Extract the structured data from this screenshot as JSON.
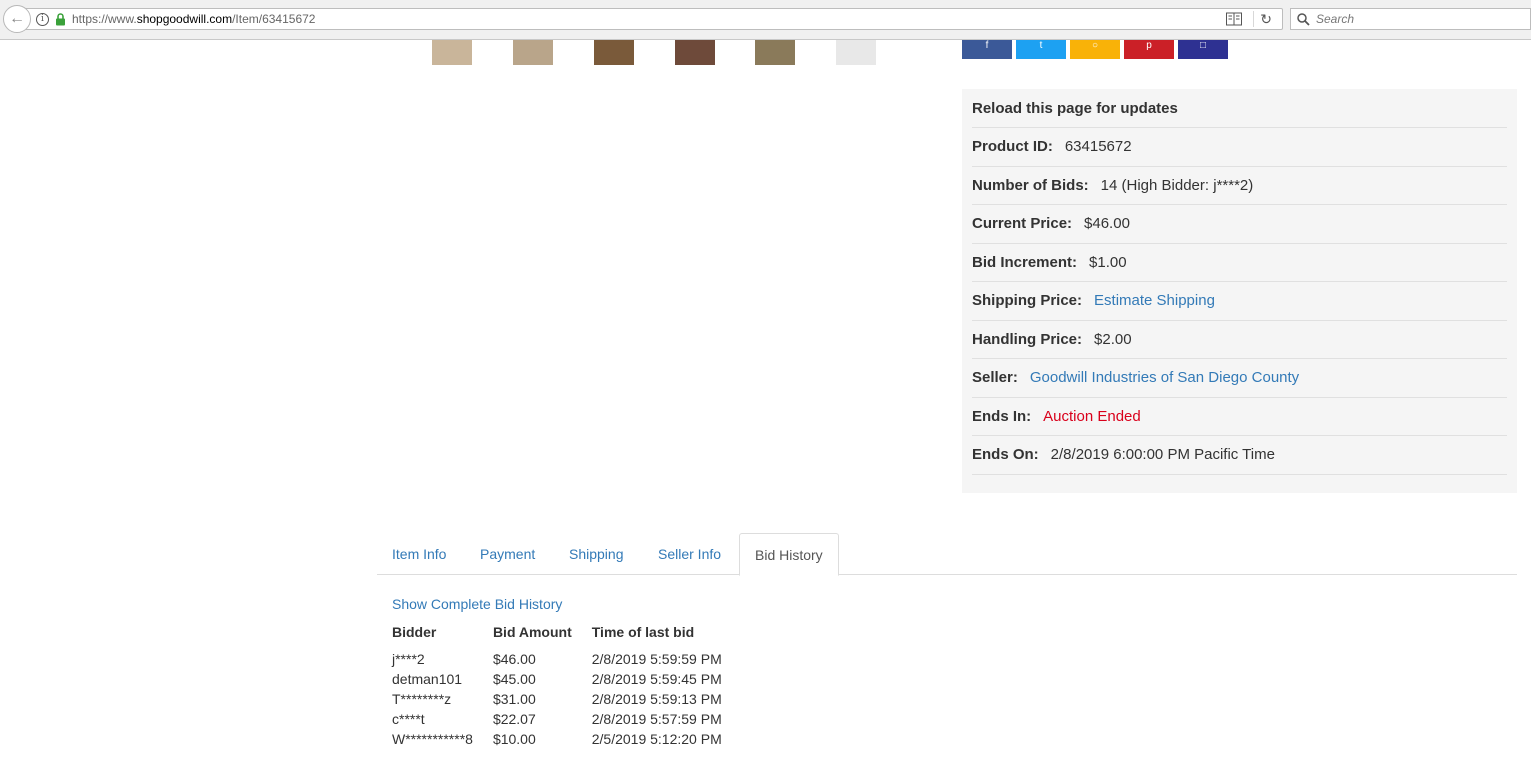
{
  "browser": {
    "url_prefix": "https://www.",
    "url_host": "shopgoodwill.com",
    "url_path": "/Item/63415672",
    "search_placeholder": "Search"
  },
  "thumbnails": [
    {
      "name": "thumbnail-1",
      "color": "#c9b59a"
    },
    {
      "name": "thumbnail-2",
      "color": "#b9a58a"
    },
    {
      "name": "thumbnail-3",
      "color": "#7a5a3a"
    },
    {
      "name": "thumbnail-4",
      "color": "#6e4a3a"
    },
    {
      "name": "thumbnail-5",
      "color": "#8a7a5a"
    },
    {
      "name": "thumbnail-6",
      "color": "#e8e8e8"
    }
  ],
  "share_buttons": [
    {
      "name": "facebook-share-button",
      "color": "#3b5998",
      "icon": "facebook-icon"
    },
    {
      "name": "twitter-share-button",
      "color": "#1da1f2",
      "icon": "twitter-icon"
    },
    {
      "name": "reddit-share-button",
      "color": "#f9b208",
      "icon": "share-icon"
    },
    {
      "name": "pinterest-share-button",
      "color": "#cb2027",
      "icon": "pinterest-icon"
    },
    {
      "name": "email-share-button",
      "color": "#2e3192",
      "icon": "email-icon"
    }
  ],
  "panel": {
    "reload": "Reload this page for updates",
    "product_id_label": "Product ID:",
    "product_id": "63415672",
    "bids_label": "Number of Bids:",
    "bids": "14 (High Bidder: j****2)",
    "price_label": "Current Price:",
    "price": "$46.00",
    "increment_label": "Bid Increment:",
    "increment": "$1.00",
    "shipping_label": "Shipping Price:",
    "shipping": "Estimate Shipping",
    "handling_label": "Handling Price:",
    "handling": "$2.00",
    "seller_label": "Seller:",
    "seller": "Goodwill Industries of San Diego County",
    "ends_in_label": "Ends In:",
    "ends_in": "Auction Ended",
    "ends_on_label": "Ends On:",
    "ends_on": "2/8/2019 6:00:00 PM Pacific Time"
  },
  "tabs": [
    "Item Info",
    "Payment",
    "Shipping",
    "Seller Info",
    "Bid History"
  ],
  "bid_history": {
    "show_complete": "Show Complete Bid History",
    "headers": [
      "Bidder",
      "Bid Amount",
      "Time of last bid"
    ],
    "rows": [
      [
        "j****2",
        "$46.00",
        "2/8/2019 5:59:59 PM"
      ],
      [
        "detman101",
        "$45.00",
        "2/8/2019 5:59:45 PM"
      ],
      [
        "T********z",
        "$31.00",
        "2/8/2019 5:59:13 PM"
      ],
      [
        "c****t",
        "$22.07",
        "2/8/2019 5:57:59 PM"
      ],
      [
        "W***********8",
        "$10.00",
        "2/5/2019 5:12:20 PM"
      ]
    ]
  }
}
